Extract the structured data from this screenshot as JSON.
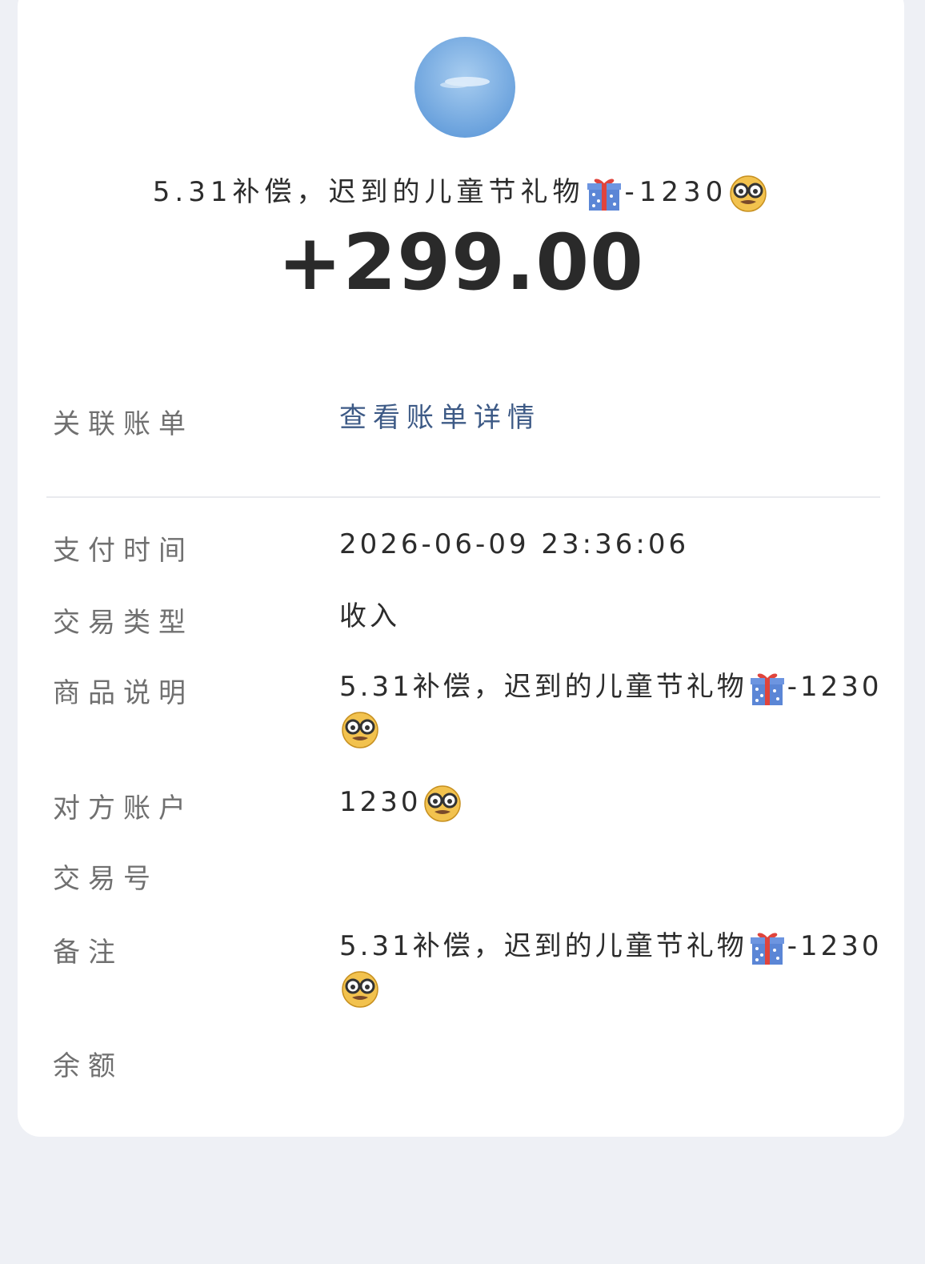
{
  "header": {
    "title": "5.31补偿，迟到的儿童节礼物",
    "title_suffix": "-1230",
    "amount": "+299.00"
  },
  "details": {
    "linked_bill_label": "关联账单",
    "linked_bill_value": "查看账单详情",
    "pay_time_label": "支付时间",
    "pay_time_value": "2026-06-09  23:36:06",
    "trade_type_label": "交易类型",
    "trade_type_value": "收入",
    "goods_desc_label": "商品说明",
    "goods_desc_value": "5.31补偿，迟到的儿童节礼物",
    "goods_desc_suffix": "-1230",
    "counterparty_label": "对方账户",
    "counterparty_value": "1230",
    "trade_no_label": "交易号",
    "trade_no_value": "",
    "remark_label": "备注",
    "remark_value": "5.31补偿，迟到的儿童节礼物",
    "remark_suffix": "-1230",
    "balance_label": "余额",
    "balance_value": ""
  },
  "icons": {
    "gift": "gift-icon",
    "face": "nerd-face-icon"
  },
  "colors": {
    "link": "#3d5a86",
    "background": "#eef0f5",
    "card": "#ffffff"
  }
}
